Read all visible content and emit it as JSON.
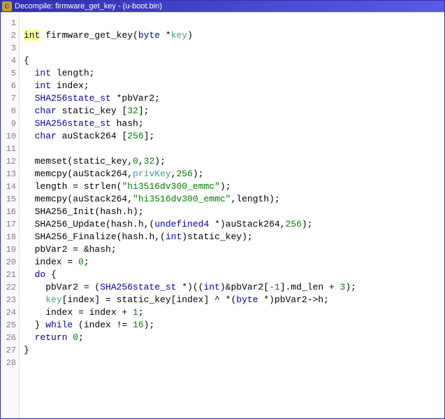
{
  "titlebar": {
    "icon_label": "C",
    "title": "Decompile: firmware_get_key - (u-boot.bin)"
  },
  "gutter": {
    "start": 1,
    "end": 28
  },
  "code": {
    "lines": [
      {
        "tokens": []
      },
      {
        "tokens": [
          [
            "ty hl",
            "int"
          ],
          [
            "id",
            " firmware_get_key("
          ],
          [
            "ty",
            "byte"
          ],
          [
            "id",
            " *"
          ],
          [
            "glob",
            "key"
          ],
          [
            "id",
            ")"
          ]
        ]
      },
      {
        "tokens": []
      },
      {
        "tokens": [
          [
            "id",
            "{"
          ]
        ]
      },
      {
        "tokens": [
          [
            "id",
            "  "
          ],
          [
            "ty",
            "int"
          ],
          [
            "id",
            " length;"
          ]
        ]
      },
      {
        "tokens": [
          [
            "id",
            "  "
          ],
          [
            "ty",
            "int"
          ],
          [
            "id",
            " index;"
          ]
        ]
      },
      {
        "tokens": [
          [
            "id",
            "  "
          ],
          [
            "ty",
            "SHA256state_st"
          ],
          [
            "id",
            " *pbVar2;"
          ]
        ]
      },
      {
        "tokens": [
          [
            "id",
            "  "
          ],
          [
            "ty",
            "char"
          ],
          [
            "id",
            " static_key ["
          ],
          [
            "num",
            "32"
          ],
          [
            "id",
            "];"
          ]
        ]
      },
      {
        "tokens": [
          [
            "id",
            "  "
          ],
          [
            "ty",
            "SHA256state_st"
          ],
          [
            "id",
            " hash;"
          ]
        ]
      },
      {
        "tokens": [
          [
            "id",
            "  "
          ],
          [
            "ty",
            "char"
          ],
          [
            "id",
            " auStack264 ["
          ],
          [
            "num",
            "256"
          ],
          [
            "id",
            "];"
          ]
        ]
      },
      {
        "tokens": []
      },
      {
        "tokens": [
          [
            "id",
            "  "
          ],
          [
            "fn",
            "memset"
          ],
          [
            "id",
            "(static_key,"
          ],
          [
            "num",
            "0"
          ],
          [
            "id",
            ","
          ],
          [
            "num",
            "32"
          ],
          [
            "id",
            ");"
          ]
        ]
      },
      {
        "tokens": [
          [
            "id",
            "  "
          ],
          [
            "fn",
            "memcpy"
          ],
          [
            "id",
            "(auStack264,"
          ],
          [
            "glob",
            "privKey"
          ],
          [
            "id",
            ","
          ],
          [
            "num",
            "256"
          ],
          [
            "id",
            ");"
          ]
        ]
      },
      {
        "tokens": [
          [
            "id",
            "  length = "
          ],
          [
            "fn",
            "strlen"
          ],
          [
            "id",
            "("
          ],
          [
            "str",
            "\"hi3516dv300_emmc\""
          ],
          [
            "id",
            ");"
          ]
        ]
      },
      {
        "tokens": [
          [
            "id",
            "  "
          ],
          [
            "fn",
            "memcpy"
          ],
          [
            "id",
            "(auStack264,"
          ],
          [
            "str",
            "\"hi3516dv300_emmc\""
          ],
          [
            "id",
            ",length);"
          ]
        ]
      },
      {
        "tokens": [
          [
            "id",
            "  "
          ],
          [
            "fn",
            "SHA256_Init"
          ],
          [
            "id",
            "(hash.h);"
          ]
        ]
      },
      {
        "tokens": [
          [
            "id",
            "  "
          ],
          [
            "fn",
            "SHA256_Update"
          ],
          [
            "id",
            "(hash.h,("
          ],
          [
            "ty",
            "undefined4"
          ],
          [
            "id",
            " *)auStack264,"
          ],
          [
            "num",
            "256"
          ],
          [
            "id",
            ");"
          ]
        ]
      },
      {
        "tokens": [
          [
            "id",
            "  "
          ],
          [
            "fn",
            "SHA256_Finalize"
          ],
          [
            "id",
            "(hash.h,("
          ],
          [
            "ty",
            "int"
          ],
          [
            "id",
            ")static_key);"
          ]
        ]
      },
      {
        "tokens": [
          [
            "id",
            "  pbVar2 = &hash;"
          ]
        ]
      },
      {
        "tokens": [
          [
            "id",
            "  index = "
          ],
          [
            "num",
            "0"
          ],
          [
            "id",
            ";"
          ]
        ]
      },
      {
        "tokens": [
          [
            "id",
            "  "
          ],
          [
            "kw",
            "do"
          ],
          [
            "id",
            " {"
          ]
        ]
      },
      {
        "tokens": [
          [
            "id",
            "    pbVar2 = ("
          ],
          [
            "ty",
            "SHA256state_st"
          ],
          [
            "id",
            " *)(("
          ],
          [
            "ty",
            "int"
          ],
          [
            "id",
            ")&pbVar2["
          ],
          [
            "num",
            "-1"
          ],
          [
            "id",
            "].md_len + "
          ],
          [
            "num",
            "3"
          ],
          [
            "id",
            ");"
          ]
        ]
      },
      {
        "tokens": [
          [
            "id",
            "    "
          ],
          [
            "glob",
            "key"
          ],
          [
            "id",
            "[index] = static_key[index] ^ *("
          ],
          [
            "ty",
            "byte"
          ],
          [
            "id",
            " *)pbVar2->h;"
          ]
        ]
      },
      {
        "tokens": [
          [
            "id",
            "    index = index + "
          ],
          [
            "num",
            "1"
          ],
          [
            "id",
            ";"
          ]
        ]
      },
      {
        "tokens": [
          [
            "id",
            "  } "
          ],
          [
            "kw",
            "while"
          ],
          [
            "id",
            " (index != "
          ],
          [
            "num",
            "16"
          ],
          [
            "id",
            ");"
          ]
        ]
      },
      {
        "tokens": [
          [
            "id",
            "  "
          ],
          [
            "kw",
            "return"
          ],
          [
            "id",
            " "
          ],
          [
            "num",
            "0"
          ],
          [
            "id",
            ";"
          ]
        ]
      },
      {
        "tokens": [
          [
            "id",
            "}"
          ]
        ]
      },
      {
        "tokens": []
      }
    ]
  }
}
